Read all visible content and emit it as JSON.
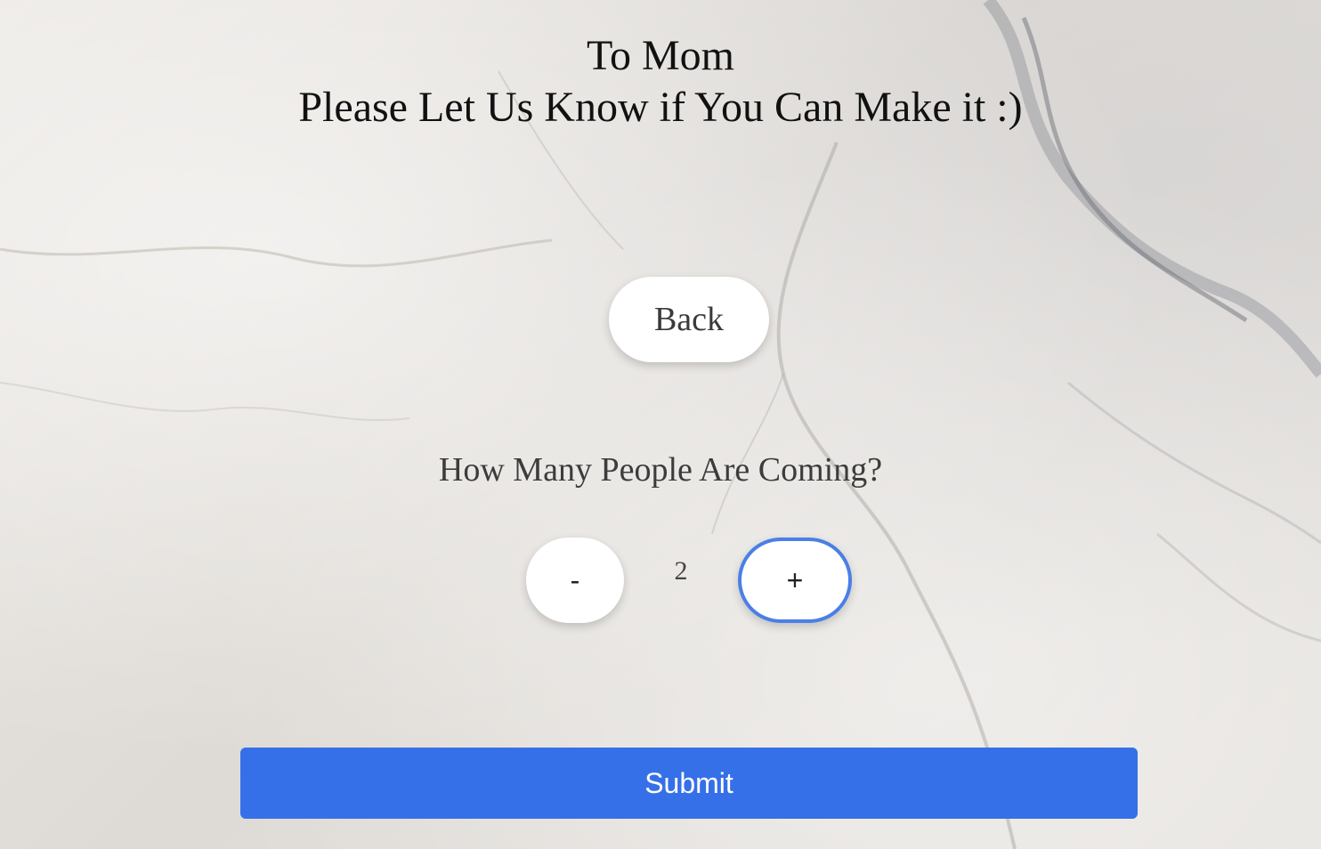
{
  "header": {
    "line1": "To Mom",
    "line2": "Please Let Us Know if You Can Make it :)"
  },
  "nav": {
    "back_label": "Back"
  },
  "guests": {
    "question": "How Many People Are Coming?",
    "decrement_label": "-",
    "count": "2",
    "increment_label": "+"
  },
  "form": {
    "submit_label": "Submit"
  },
  "colors": {
    "accent": "#3570e8",
    "focus_ring": "#4a7fe6",
    "background": "#e3e0dc"
  }
}
